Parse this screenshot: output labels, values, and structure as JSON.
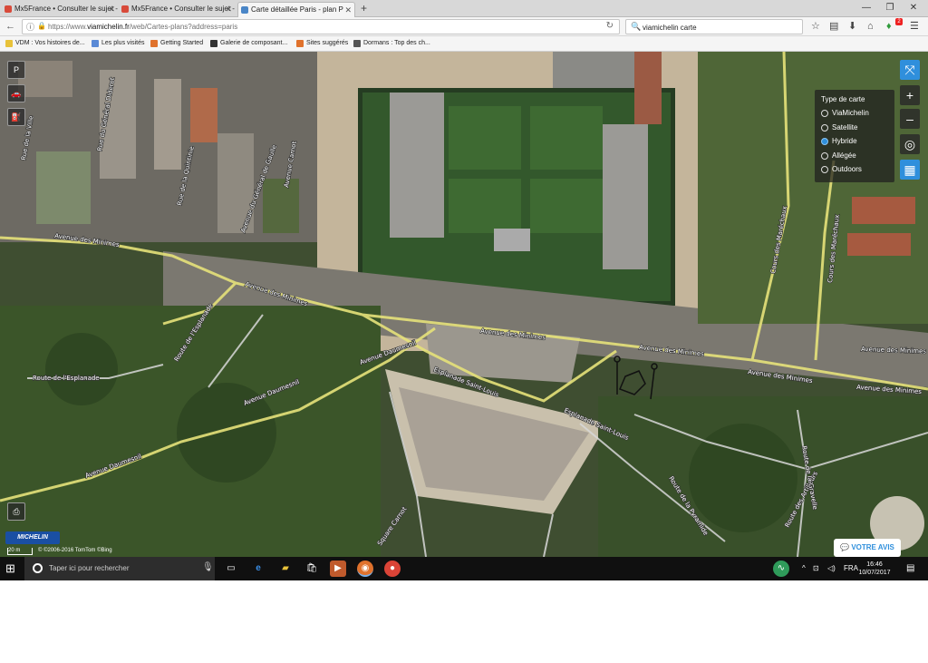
{
  "browser": {
    "tabs": [
      {
        "title": "Mx5France • Consulter le sujet -"
      },
      {
        "title": "Mx5France • Consulter le sujet -"
      },
      {
        "title": "Carte détaillée Paris - plan P"
      }
    ],
    "url_prefix": "https://www.",
    "url_domain": "viamichelin.fr",
    "url_path": "/web/Cartes-plans?address=paris",
    "search_value": "viamichelin carte",
    "notification_count": "2",
    "bookmarks": [
      {
        "label": "VDM : Vos histoires de...",
        "color": "#e8c23a"
      },
      {
        "label": "Les plus visités",
        "color": "#5a8ad6"
      },
      {
        "label": "Getting Started",
        "color": "#e0722c"
      },
      {
        "label": "Galerie de composant...",
        "color": "#333333"
      },
      {
        "label": "Sites suggérés",
        "color": "#e0722c"
      },
      {
        "label": "Dormans : Top des ch...",
        "color": "#555555"
      }
    ]
  },
  "map": {
    "street_labels": {
      "minimes_nw": "Avenue des Minimes",
      "minimes_center": "Avenue des Minimes",
      "minimes_mid": "Avenue des Minimes",
      "minimes_e1": "Avenue des Minimes",
      "minimes_e2": "Avenue des Minimes",
      "minimes_far_e": "Avenue des Minimes",
      "minimes_far_e2": "Avenue des Minimes",
      "daumesnil_w": "Avenue Daumesnil",
      "daumesnil_sw": "Avenue Daumesnil",
      "daumesnil_c": "Avenue Daumesnil",
      "esplanade_route": "Route de l'Esplanade",
      "route_esplanade_v": "Route de l'Esplanade",
      "esplanade_st_louis": "Esplanade Saint-Louis",
      "esplanade_st_louis_2": "Esplanade Saint-Louis",
      "cours_marechaux": "Cours des Maréchaux",
      "cours_marechaux_2": "Cours des Maréchaux",
      "route_pyramide": "Route de la Pyramide",
      "route_artilleurs": "Route des Artilleurs",
      "route_gravelle": "Route de la Gravelle",
      "square_carnot": "Square Carnot",
      "rue_carnot": "Avenue Carnot",
      "rue_diderot": "Rue du Général Diderot",
      "rue_quintinie": "Rue de la Quintinie",
      "rue_gaulle": "Avenue du Général de Gaulle",
      "rue_ville": "Rue de la Ville"
    },
    "map_type_panel": {
      "title": "Type de carte",
      "options": [
        "ViaMichelin",
        "Satellite",
        "Hybride",
        "Allégée",
        "Outdoors"
      ],
      "selected": "Hybride"
    },
    "brand": "MICHELIN",
    "scale_text": "20 m",
    "copyright": "© ©2006-2016 TomTom ©Bing",
    "feedback_button": "VOTRE AVIS",
    "zoom_in": "+",
    "zoom_out": "–"
  },
  "taskbar": {
    "search_placeholder": "Taper ici pour rechercher",
    "language": "FRA",
    "time": "16:46",
    "date": "10/07/2017"
  },
  "colors": {
    "accent_blue": "#2f8fdc",
    "road_yellow": "#e6e27a",
    "road_grey": "#d8d8d8"
  }
}
